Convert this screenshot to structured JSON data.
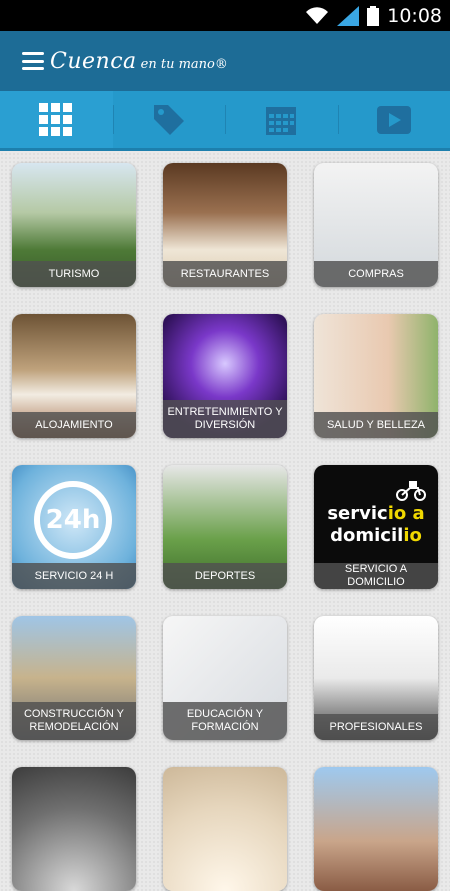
{
  "status_bar": {
    "time": "10:08",
    "icons": [
      "wifi-icon",
      "signal-icon",
      "battery-icon"
    ]
  },
  "app_bar": {
    "logo_main": "Cuenca",
    "logo_rest": "en tu mano®",
    "menu_icon": "menu-icon"
  },
  "tabs": [
    {
      "icon": "grid-icon",
      "active": true
    },
    {
      "icon": "tag-icon",
      "active": false
    },
    {
      "icon": "calendar-icon",
      "active": false
    },
    {
      "icon": "video-icon",
      "active": false
    }
  ],
  "categories": [
    {
      "label": "TURISMO"
    },
    {
      "label": "RESTAURANTES"
    },
    {
      "label": "COMPRAS"
    },
    {
      "label": "ALOJAMIENTO"
    },
    {
      "label": "ENTRETENIMIENTO Y DIVERSIÓN"
    },
    {
      "label": "SALUD Y BELLEZA"
    },
    {
      "label": "SERVICIO 24 H",
      "art_text": "24h"
    },
    {
      "label": "DEPORTES"
    },
    {
      "label": "SERVICIO A DOMICILIO",
      "art_text": [
        "servic",
        "io a",
        "domicil",
        "io"
      ]
    },
    {
      "label": "CONSTRUCCIÓN Y REMODELACIÓN"
    },
    {
      "label": "EDUCACIÓN Y FORMACIÓN"
    },
    {
      "label": "PROFESIONALES"
    },
    {
      "label": ""
    },
    {
      "label": ""
    },
    {
      "label": ""
    }
  ],
  "colors": {
    "app_bar": "#1d6c96",
    "tab_bar": "#2599cb",
    "background": "#e9e9e9",
    "accent_yellow": "#f0d800"
  }
}
